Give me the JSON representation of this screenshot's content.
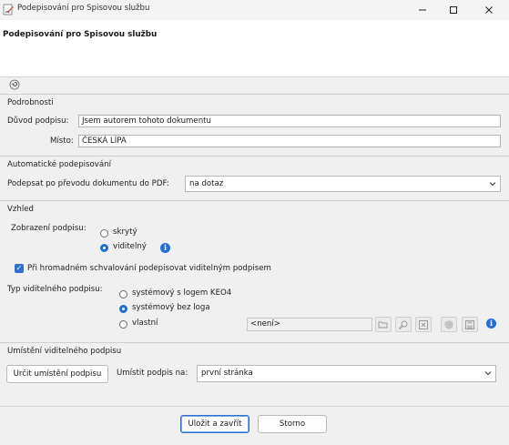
{
  "window": {
    "title": "Podepisování pro Spisovou službu",
    "minimize_icon": "minimize-icon",
    "maximize_icon": "maximize-icon",
    "close_icon": "close-icon"
  },
  "header": {
    "title": "Podepisování pro Spisovou službu"
  },
  "details": {
    "group_label": "Podrobnosti",
    "reason_label": "Důvod podpisu:",
    "reason_value": "Jsem autorem tohoto dokumentu",
    "place_label": "Místo:",
    "place_value": "ČESKÁ LÍPA"
  },
  "auto_sign": {
    "group_label": "Automatické podepisování",
    "sign_after_label": "Podepsat po převodu dokumentu do PDF:",
    "sign_after_value": "na dotaz"
  },
  "appearance": {
    "group_label": "Vzhled",
    "display_label": "Zobrazení podpisu:",
    "option_hidden": "skrytý",
    "option_visible": "viditelný",
    "selected_display": "viditelný",
    "bulk_approve_label": "Při hromadném schvalování podepisovat viditelným podpisem",
    "bulk_approve_checked": true,
    "type_label": "Typ viditelného podpisu:",
    "type_option_logo": "systémový s logem KEO4",
    "type_option_nologo": "systémový bez loga",
    "type_option_custom": "vlastní",
    "selected_type": "systémový bez loga",
    "custom_file_value": "<není>"
  },
  "placement": {
    "group_label": "Umístění viditelného podpisu",
    "determine_button": "Určit umístění podpisu",
    "place_on_label": "Umístit podpis na:",
    "place_on_value": "první stránka"
  },
  "footer": {
    "save_close_button": "Uložit a zavřít",
    "cancel_button": "Storno"
  },
  "colors": {
    "accent": "#1f6fd6",
    "background": "#f0f0f0"
  }
}
